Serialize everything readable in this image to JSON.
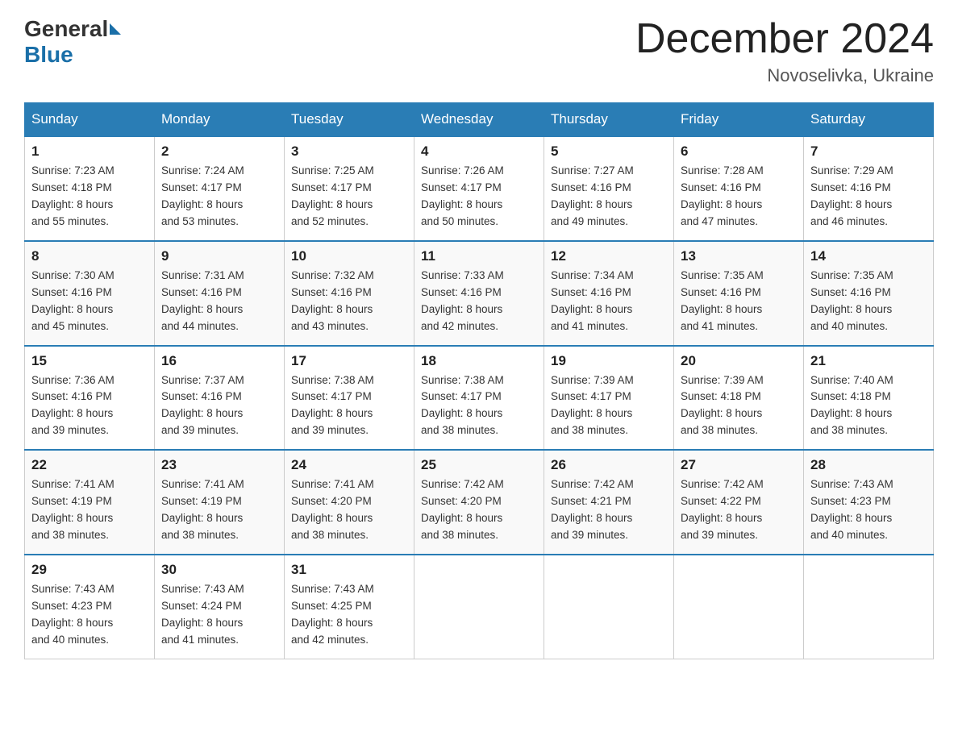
{
  "header": {
    "logo_general": "General",
    "logo_blue": "Blue",
    "month_title": "December 2024",
    "location": "Novoselivka, Ukraine"
  },
  "days_of_week": [
    "Sunday",
    "Monday",
    "Tuesday",
    "Wednesday",
    "Thursday",
    "Friday",
    "Saturday"
  ],
  "weeks": [
    [
      {
        "day": "1",
        "sunrise": "7:23 AM",
        "sunset": "4:18 PM",
        "daylight": "8 hours and 55 minutes."
      },
      {
        "day": "2",
        "sunrise": "7:24 AM",
        "sunset": "4:17 PM",
        "daylight": "8 hours and 53 minutes."
      },
      {
        "day": "3",
        "sunrise": "7:25 AM",
        "sunset": "4:17 PM",
        "daylight": "8 hours and 52 minutes."
      },
      {
        "day": "4",
        "sunrise": "7:26 AM",
        "sunset": "4:17 PM",
        "daylight": "8 hours and 50 minutes."
      },
      {
        "day": "5",
        "sunrise": "7:27 AM",
        "sunset": "4:16 PM",
        "daylight": "8 hours and 49 minutes."
      },
      {
        "day": "6",
        "sunrise": "7:28 AM",
        "sunset": "4:16 PM",
        "daylight": "8 hours and 47 minutes."
      },
      {
        "day": "7",
        "sunrise": "7:29 AM",
        "sunset": "4:16 PM",
        "daylight": "8 hours and 46 minutes."
      }
    ],
    [
      {
        "day": "8",
        "sunrise": "7:30 AM",
        "sunset": "4:16 PM",
        "daylight": "8 hours and 45 minutes."
      },
      {
        "day": "9",
        "sunrise": "7:31 AM",
        "sunset": "4:16 PM",
        "daylight": "8 hours and 44 minutes."
      },
      {
        "day": "10",
        "sunrise": "7:32 AM",
        "sunset": "4:16 PM",
        "daylight": "8 hours and 43 minutes."
      },
      {
        "day": "11",
        "sunrise": "7:33 AM",
        "sunset": "4:16 PM",
        "daylight": "8 hours and 42 minutes."
      },
      {
        "day": "12",
        "sunrise": "7:34 AM",
        "sunset": "4:16 PM",
        "daylight": "8 hours and 41 minutes."
      },
      {
        "day": "13",
        "sunrise": "7:35 AM",
        "sunset": "4:16 PM",
        "daylight": "8 hours and 41 minutes."
      },
      {
        "day": "14",
        "sunrise": "7:35 AM",
        "sunset": "4:16 PM",
        "daylight": "8 hours and 40 minutes."
      }
    ],
    [
      {
        "day": "15",
        "sunrise": "7:36 AM",
        "sunset": "4:16 PM",
        "daylight": "8 hours and 39 minutes."
      },
      {
        "day": "16",
        "sunrise": "7:37 AM",
        "sunset": "4:16 PM",
        "daylight": "8 hours and 39 minutes."
      },
      {
        "day": "17",
        "sunrise": "7:38 AM",
        "sunset": "4:17 PM",
        "daylight": "8 hours and 39 minutes."
      },
      {
        "day": "18",
        "sunrise": "7:38 AM",
        "sunset": "4:17 PM",
        "daylight": "8 hours and 38 minutes."
      },
      {
        "day": "19",
        "sunrise": "7:39 AM",
        "sunset": "4:17 PM",
        "daylight": "8 hours and 38 minutes."
      },
      {
        "day": "20",
        "sunrise": "7:39 AM",
        "sunset": "4:18 PM",
        "daylight": "8 hours and 38 minutes."
      },
      {
        "day": "21",
        "sunrise": "7:40 AM",
        "sunset": "4:18 PM",
        "daylight": "8 hours and 38 minutes."
      }
    ],
    [
      {
        "day": "22",
        "sunrise": "7:41 AM",
        "sunset": "4:19 PM",
        "daylight": "8 hours and 38 minutes."
      },
      {
        "day": "23",
        "sunrise": "7:41 AM",
        "sunset": "4:19 PM",
        "daylight": "8 hours and 38 minutes."
      },
      {
        "day": "24",
        "sunrise": "7:41 AM",
        "sunset": "4:20 PM",
        "daylight": "8 hours and 38 minutes."
      },
      {
        "day": "25",
        "sunrise": "7:42 AM",
        "sunset": "4:20 PM",
        "daylight": "8 hours and 38 minutes."
      },
      {
        "day": "26",
        "sunrise": "7:42 AM",
        "sunset": "4:21 PM",
        "daylight": "8 hours and 39 minutes."
      },
      {
        "day": "27",
        "sunrise": "7:42 AM",
        "sunset": "4:22 PM",
        "daylight": "8 hours and 39 minutes."
      },
      {
        "day": "28",
        "sunrise": "7:43 AM",
        "sunset": "4:23 PM",
        "daylight": "8 hours and 40 minutes."
      }
    ],
    [
      {
        "day": "29",
        "sunrise": "7:43 AM",
        "sunset": "4:23 PM",
        "daylight": "8 hours and 40 minutes."
      },
      {
        "day": "30",
        "sunrise": "7:43 AM",
        "sunset": "4:24 PM",
        "daylight": "8 hours and 41 minutes."
      },
      {
        "day": "31",
        "sunrise": "7:43 AM",
        "sunset": "4:25 PM",
        "daylight": "8 hours and 42 minutes."
      },
      null,
      null,
      null,
      null
    ]
  ],
  "labels": {
    "sunrise": "Sunrise:",
    "sunset": "Sunset:",
    "daylight": "Daylight:"
  }
}
